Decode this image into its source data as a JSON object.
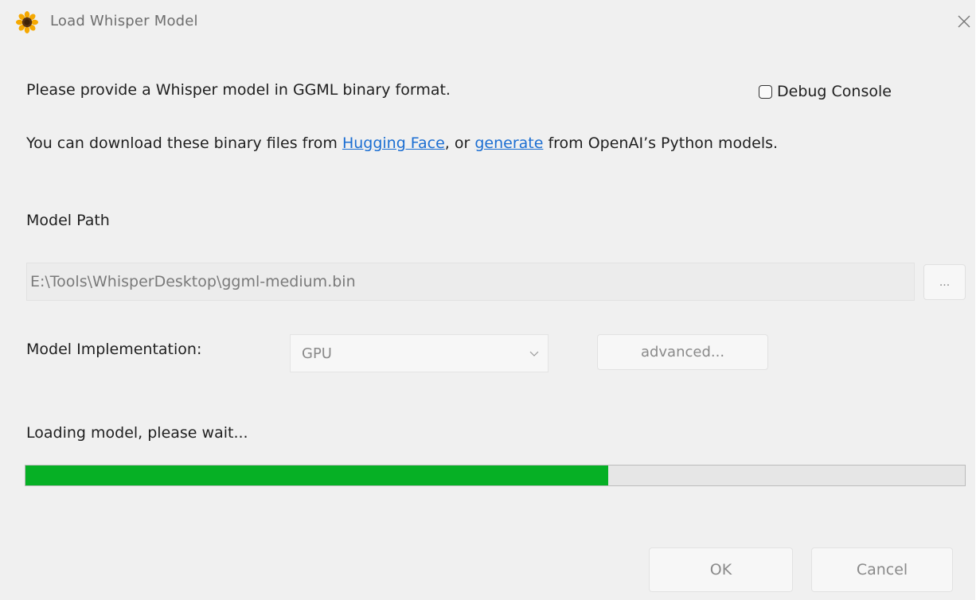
{
  "window": {
    "title": "Load Whisper Model",
    "icon": "sunflower-icon",
    "close_icon": "close-icon"
  },
  "intro": {
    "line1": "Please provide a Whisper model in GGML binary format.",
    "line2_prefix": "You can download these binary files from ",
    "link_hugging_face": "Hugging Face",
    "line2_mid": ", or ",
    "link_generate": "generate",
    "line2_suffix": " from OpenAI’s Python models."
  },
  "debug_console": {
    "label": "Debug Console",
    "checked": false
  },
  "model_path": {
    "label": "Model Path",
    "value": "E:\\Tools\\WhisperDesktop\\ggml-medium.bin",
    "browse_label": "..."
  },
  "model_implementation": {
    "label": "Model Implementation:",
    "selected": "GPU",
    "advanced_label": "advanced..."
  },
  "loading": {
    "status": "Loading model, please wait...",
    "progress_percent": 62
  },
  "buttons": {
    "ok_label": "OK",
    "cancel_label": "Cancel"
  },
  "colors": {
    "background": "#f0f0f0",
    "link": "#1b6ed2",
    "progress_fill": "#06b025",
    "progress_track": "#e6e6e6",
    "disabled_text": "#8a8a8a"
  }
}
